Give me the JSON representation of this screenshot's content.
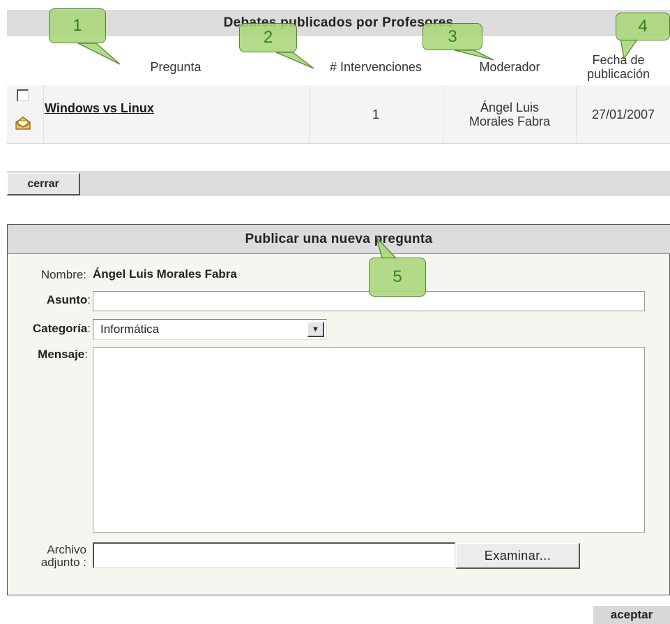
{
  "debates": {
    "title": "Debates publicados por Profesores",
    "columns": [
      "Pregunta",
      "# Intervenciones",
      "Moderador",
      "Fecha de publicación"
    ],
    "rows": [
      {
        "question": "Windows vs Linux",
        "interventions": "1",
        "moderator": "Ángel Luis Morales Fabra",
        "date": "27/01/2007"
      }
    ],
    "close_label": "cerrar"
  },
  "new_question": {
    "title": "Publicar una nueva pregunta",
    "name_label": "Nombre:",
    "name_value": "Ángel Luis Morales Fabra",
    "subject_label": "Asunto",
    "subject_colon": ":",
    "subject_value": "",
    "category_label": "Categoría",
    "category_colon": ":",
    "category_value": "Informática",
    "message_label": "Mensaje",
    "message_colon": ":",
    "message_value": "",
    "attachment_label_1": "Archivo",
    "attachment_label_2": "adjunto :",
    "browse_label": "Examinar...",
    "accept_label": "aceptar"
  },
  "callouts": [
    "1",
    "2",
    "3",
    "4",
    "5"
  ],
  "colors": {
    "callout_fill": "#a9d77a",
    "callout_border": "#3d7a1c",
    "header_bg": "#dcdcdc"
  },
  "icons": {
    "row_checkbox": "checkbox-icon",
    "row_status": "open-envelope-icon",
    "select_arrow": "chevron-down-icon"
  }
}
